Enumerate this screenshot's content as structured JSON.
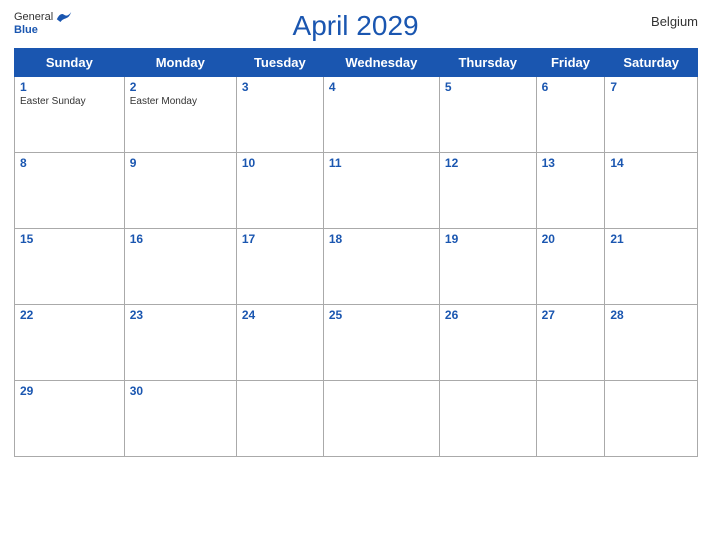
{
  "header": {
    "logo": {
      "general": "General",
      "blue": "Blue",
      "bird_label": "bird-logo"
    },
    "title": "April 2029",
    "country": "Belgium"
  },
  "days_of_week": [
    "Sunday",
    "Monday",
    "Tuesday",
    "Wednesday",
    "Thursday",
    "Friday",
    "Saturday"
  ],
  "weeks": [
    [
      {
        "num": "1",
        "holiday": "Easter Sunday"
      },
      {
        "num": "2",
        "holiday": "Easter Monday"
      },
      {
        "num": "3",
        "holiday": ""
      },
      {
        "num": "4",
        "holiday": ""
      },
      {
        "num": "5",
        "holiday": ""
      },
      {
        "num": "6",
        "holiday": ""
      },
      {
        "num": "7",
        "holiday": ""
      }
    ],
    [
      {
        "num": "8",
        "holiday": ""
      },
      {
        "num": "9",
        "holiday": ""
      },
      {
        "num": "10",
        "holiday": ""
      },
      {
        "num": "11",
        "holiday": ""
      },
      {
        "num": "12",
        "holiday": ""
      },
      {
        "num": "13",
        "holiday": ""
      },
      {
        "num": "14",
        "holiday": ""
      }
    ],
    [
      {
        "num": "15",
        "holiday": ""
      },
      {
        "num": "16",
        "holiday": ""
      },
      {
        "num": "17",
        "holiday": ""
      },
      {
        "num": "18",
        "holiday": ""
      },
      {
        "num": "19",
        "holiday": ""
      },
      {
        "num": "20",
        "holiday": ""
      },
      {
        "num": "21",
        "holiday": ""
      }
    ],
    [
      {
        "num": "22",
        "holiday": ""
      },
      {
        "num": "23",
        "holiday": ""
      },
      {
        "num": "24",
        "holiday": ""
      },
      {
        "num": "25",
        "holiday": ""
      },
      {
        "num": "26",
        "holiday": ""
      },
      {
        "num": "27",
        "holiday": ""
      },
      {
        "num": "28",
        "holiday": ""
      }
    ],
    [
      {
        "num": "29",
        "holiday": ""
      },
      {
        "num": "30",
        "holiday": ""
      },
      {
        "num": "",
        "holiday": ""
      },
      {
        "num": "",
        "holiday": ""
      },
      {
        "num": "",
        "holiday": ""
      },
      {
        "num": "",
        "holiday": ""
      },
      {
        "num": "",
        "holiday": ""
      }
    ]
  ]
}
